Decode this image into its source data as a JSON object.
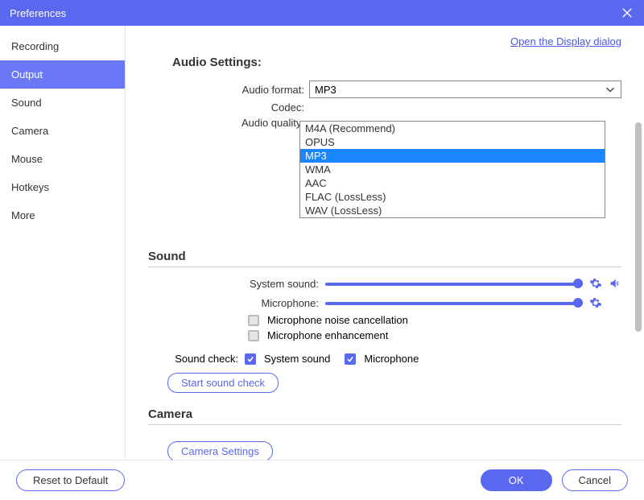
{
  "window": {
    "title": "Preferences"
  },
  "toplink": "Open the Display dialog",
  "sidebar": {
    "items": [
      {
        "label": "Recording"
      },
      {
        "label": "Output"
      },
      {
        "label": "Sound"
      },
      {
        "label": "Camera"
      },
      {
        "label": "Mouse"
      },
      {
        "label": "Hotkeys"
      },
      {
        "label": "More"
      }
    ],
    "active_index": 1
  },
  "audio": {
    "section_title": "Audio Settings:",
    "format_label": "Audio format:",
    "codec_label": "Codec:",
    "quality_label": "Audio quality:",
    "format_value": "MP3",
    "dropdown_options": [
      "M4A (Recommend)",
      "OPUS",
      "MP3",
      "WMA",
      "AAC",
      "FLAC (LossLess)",
      "WAV (LossLess)"
    ],
    "dropdown_selected_index": 2
  },
  "sound": {
    "section_title": "Sound",
    "system_label": "System sound:",
    "mic_label": "Microphone:",
    "noise_cancel_label": "Microphone noise cancellation",
    "enhancement_label": "Microphone enhancement",
    "soundcheck_label": "Sound check:",
    "sc_system_label": "System sound",
    "sc_mic_label": "Microphone",
    "start_label": "Start sound check"
  },
  "camera": {
    "section_title": "Camera",
    "settings_label": "Camera Settings"
  },
  "footer": {
    "reset": "Reset to Default",
    "ok": "OK",
    "cancel": "Cancel"
  }
}
